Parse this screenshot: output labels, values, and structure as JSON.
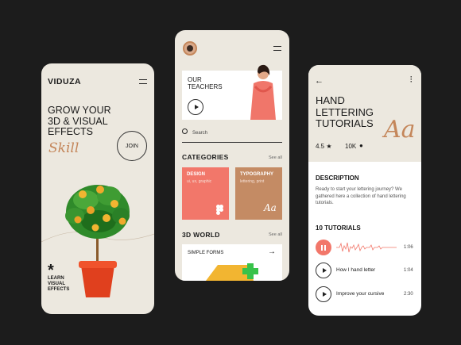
{
  "screen1": {
    "brand": "VIDUZA",
    "headline_lines": [
      "GROW YOUR",
      "3D & VISUAL",
      "EFFECTS"
    ],
    "script_word": "Skill",
    "join_label": "JOIN",
    "asterisk": "*",
    "learn_lines": [
      "LEARN",
      "VISUAL",
      "EFFECTS"
    ]
  },
  "screen2": {
    "teachers_lines": [
      "OUR",
      "TEACHERS"
    ],
    "search_placeholder": "Search",
    "categories_title": "CATEGORIES",
    "see_all": "See all",
    "tiles": [
      {
        "label": "DESIGN",
        "sub": "ui, ux, graphic"
      },
      {
        "label": "TYPOGRAPHY",
        "sub": "lettering, print"
      }
    ],
    "tile2_glyph": "Aa",
    "world_title": "3D WORLD",
    "world_see_all": "See all",
    "simple_forms": "SIMPLE FORMS"
  },
  "screen3": {
    "title_lines": [
      "HAND",
      "LETTERING",
      "TUTORIALS"
    ],
    "script_glyph": "Aa",
    "rating": "4.5 ★",
    "followers": "10K",
    "description_title": "DESCRIPTION",
    "description": "Ready to start your lettering journey? We gathered here a collection of hand lettering tutorials.",
    "tutorials_title": "10 TUTORIALS",
    "tutorials": [
      {
        "title": "",
        "time": "1:06",
        "playing": true
      },
      {
        "title": "How I hand letter",
        "time": "1:04",
        "playing": false
      },
      {
        "title": "Improve your cursive",
        "time": "2:30",
        "playing": false
      }
    ]
  },
  "colors": {
    "coral": "#f2776a",
    "tan": "#c48b64",
    "cream": "#ece8df",
    "dark_bg": "#1c1c1c"
  }
}
